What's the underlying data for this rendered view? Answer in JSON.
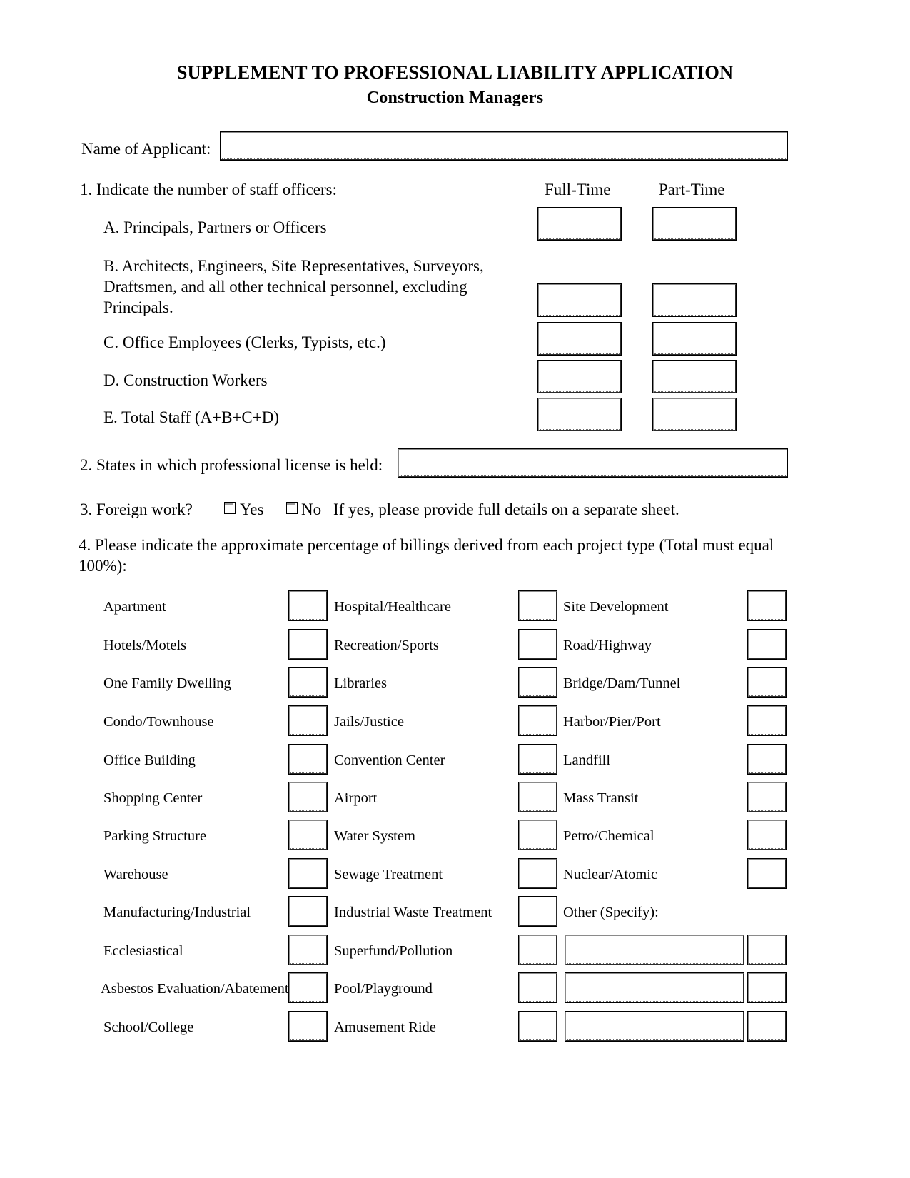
{
  "document": {
    "title_main": "SUPPLEMENT TO PROFESSIONAL LIABILITY APPLICATION",
    "title_sub": "Construction Managers"
  },
  "applicant": {
    "label": "Name of Applicant:",
    "value": ""
  },
  "question1": {
    "prompt": "1. Indicate the number of staff officers:",
    "col_fulltime": "Full-Time",
    "col_parttime": "Part-Time",
    "rows": [
      {
        "label": "A. Principals, Partners or Officers",
        "full_time": "",
        "part_time": ""
      },
      {
        "label": "B. Architects, Engineers, Site Representatives, Surveyors, Draftsmen, and all other technical personnel, excluding Principals.",
        "full_time": "",
        "part_time": ""
      },
      {
        "label": "C. Office Employees (Clerks, Typists, etc.)",
        "full_time": "",
        "part_time": ""
      },
      {
        "label": "D. Construction Workers",
        "full_time": "",
        "part_time": ""
      },
      {
        "label": "E. Total Staff (A+B+C+D)",
        "full_time": "",
        "part_time": ""
      }
    ]
  },
  "question2": {
    "prompt": "2. States in which professional license is held:",
    "value": ""
  },
  "question3": {
    "prompt": "3. Foreign work?",
    "yes_label": "Yes",
    "no_label": "No",
    "note": "If yes, please provide full details on a separate sheet.",
    "yes_checked": false,
    "no_checked": false
  },
  "question4": {
    "prompt": "4. Please indicate the approximate percentage of billings derived from each project type (Total must equal 100%):",
    "column1": [
      {
        "label": "Apartment",
        "value": ""
      },
      {
        "label": "Hotels/Motels",
        "value": ""
      },
      {
        "label": "One Family Dwelling",
        "value": ""
      },
      {
        "label": "Condo/Townhouse",
        "value": ""
      },
      {
        "label": "Office Building",
        "value": ""
      },
      {
        "label": "Shopping Center",
        "value": ""
      },
      {
        "label": "Parking Structure",
        "value": ""
      },
      {
        "label": "Warehouse",
        "value": ""
      },
      {
        "label": "Manufacturing/Industrial",
        "value": ""
      },
      {
        "label": "Ecclesiastical",
        "value": ""
      },
      {
        "label": "Asbestos Evaluation/Abatement",
        "value": ""
      },
      {
        "label": "School/College",
        "value": ""
      }
    ],
    "column2": [
      {
        "label": "Hospital/Healthcare",
        "value": ""
      },
      {
        "label": "Recreation/Sports",
        "value": ""
      },
      {
        "label": "Libraries",
        "value": ""
      },
      {
        "label": "Jails/Justice",
        "value": ""
      },
      {
        "label": "Convention Center",
        "value": ""
      },
      {
        "label": "Airport",
        "value": ""
      },
      {
        "label": "Water System",
        "value": ""
      },
      {
        "label": "Sewage Treatment",
        "value": ""
      },
      {
        "label": "Industrial Waste Treatment",
        "value": ""
      },
      {
        "label": "Superfund/Pollution",
        "value": ""
      },
      {
        "label": "Pool/Playground",
        "value": ""
      },
      {
        "label": "Amusement Ride",
        "value": ""
      }
    ],
    "column3": [
      {
        "label": "Site Development",
        "value": ""
      },
      {
        "label": "Road/Highway",
        "value": ""
      },
      {
        "label": "Bridge/Dam/Tunnel",
        "value": ""
      },
      {
        "label": "Harbor/Pier/Port",
        "value": ""
      },
      {
        "label": "Landfill",
        "value": ""
      },
      {
        "label": "Mass Transit",
        "value": ""
      },
      {
        "label": "Petro/Chemical",
        "value": ""
      },
      {
        "label": "Nuclear/Atomic",
        "value": ""
      },
      {
        "label": "Other (Specify):",
        "value": ""
      }
    ],
    "other_rows": [
      {
        "specify": "",
        "value": ""
      },
      {
        "specify": "",
        "value": ""
      },
      {
        "specify": "",
        "value": ""
      }
    ]
  }
}
